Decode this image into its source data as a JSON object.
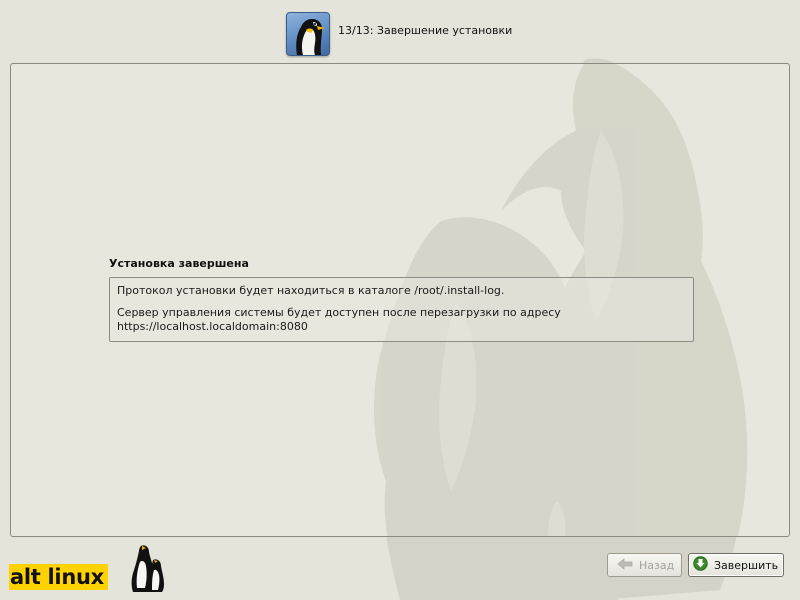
{
  "header": {
    "step_title": "13/13: Завершение установки",
    "icon": "penguin-icon"
  },
  "content": {
    "title": "Установка завершена",
    "message_line1": "Протокол установки будет находиться в каталоге /root/.install-log.",
    "message_line2": "Сервер управления системы будет доступен после перезагрузки по адресу",
    "message_line3": "https://localhost.localdomain:8080"
  },
  "footer": {
    "logo_text": "alt linux",
    "back_label": "Назад",
    "back_icon": "arrow-left-icon",
    "back_enabled": false,
    "finish_label": "Завершить",
    "finish_icon": "arrow-down-circle-icon"
  },
  "colors": {
    "background": "#e5e4db",
    "logo_yellow": "#ffd200",
    "finish_icon_green": "#3a8a2a"
  }
}
